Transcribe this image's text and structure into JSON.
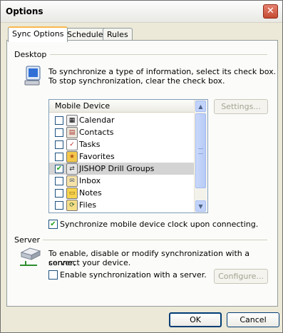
{
  "window": {
    "title": "Options",
    "close_glyph": "✕"
  },
  "tabs": [
    {
      "label": "Sync Options",
      "active": true
    },
    {
      "label": "Schedule",
      "active": false
    },
    {
      "label": "Rules",
      "active": false
    }
  ],
  "desktop": {
    "section_label": "Desktop",
    "icon": "monitor-icon",
    "line1": "To synchronize a type of information, select its check box.",
    "line2": "To stop synchronization, clear the check box.",
    "list_header": "Mobile Device",
    "items": [
      {
        "label": "Calendar",
        "checked": false,
        "icon": "calendar-icon"
      },
      {
        "label": "Contacts",
        "checked": false,
        "icon": "contacts-icon"
      },
      {
        "label": "Tasks",
        "checked": false,
        "icon": "tasks-icon"
      },
      {
        "label": "Favorites",
        "checked": false,
        "icon": "favorites-icon"
      },
      {
        "label": "JISHOP Drill Groups",
        "checked": true,
        "icon": "sync-provider-icon"
      },
      {
        "label": "Inbox",
        "checked": false,
        "icon": "inbox-icon"
      },
      {
        "label": "Notes",
        "checked": false,
        "icon": "notes-icon"
      },
      {
        "label": "Files",
        "checked": false,
        "icon": "files-icon"
      }
    ],
    "settings_label": "Settings...",
    "clock_sync_label": "Synchronize mobile device clock upon connecting.",
    "clock_sync_checked": true
  },
  "server": {
    "section_label": "Server",
    "icon": "server-icon",
    "line1": "To enable, disable or modify synchronization with a server,",
    "line2": "connect your device.",
    "enable_label": "Enable synchronization with a server.",
    "enable_checked": false,
    "configure_label": "Configure..."
  },
  "footer": {
    "ok_label": "OK",
    "cancel_label": "Cancel"
  },
  "colors": {
    "accent_tab": "#f8b850",
    "check_mark": "#21a121",
    "selection": "#d4d4d4"
  }
}
